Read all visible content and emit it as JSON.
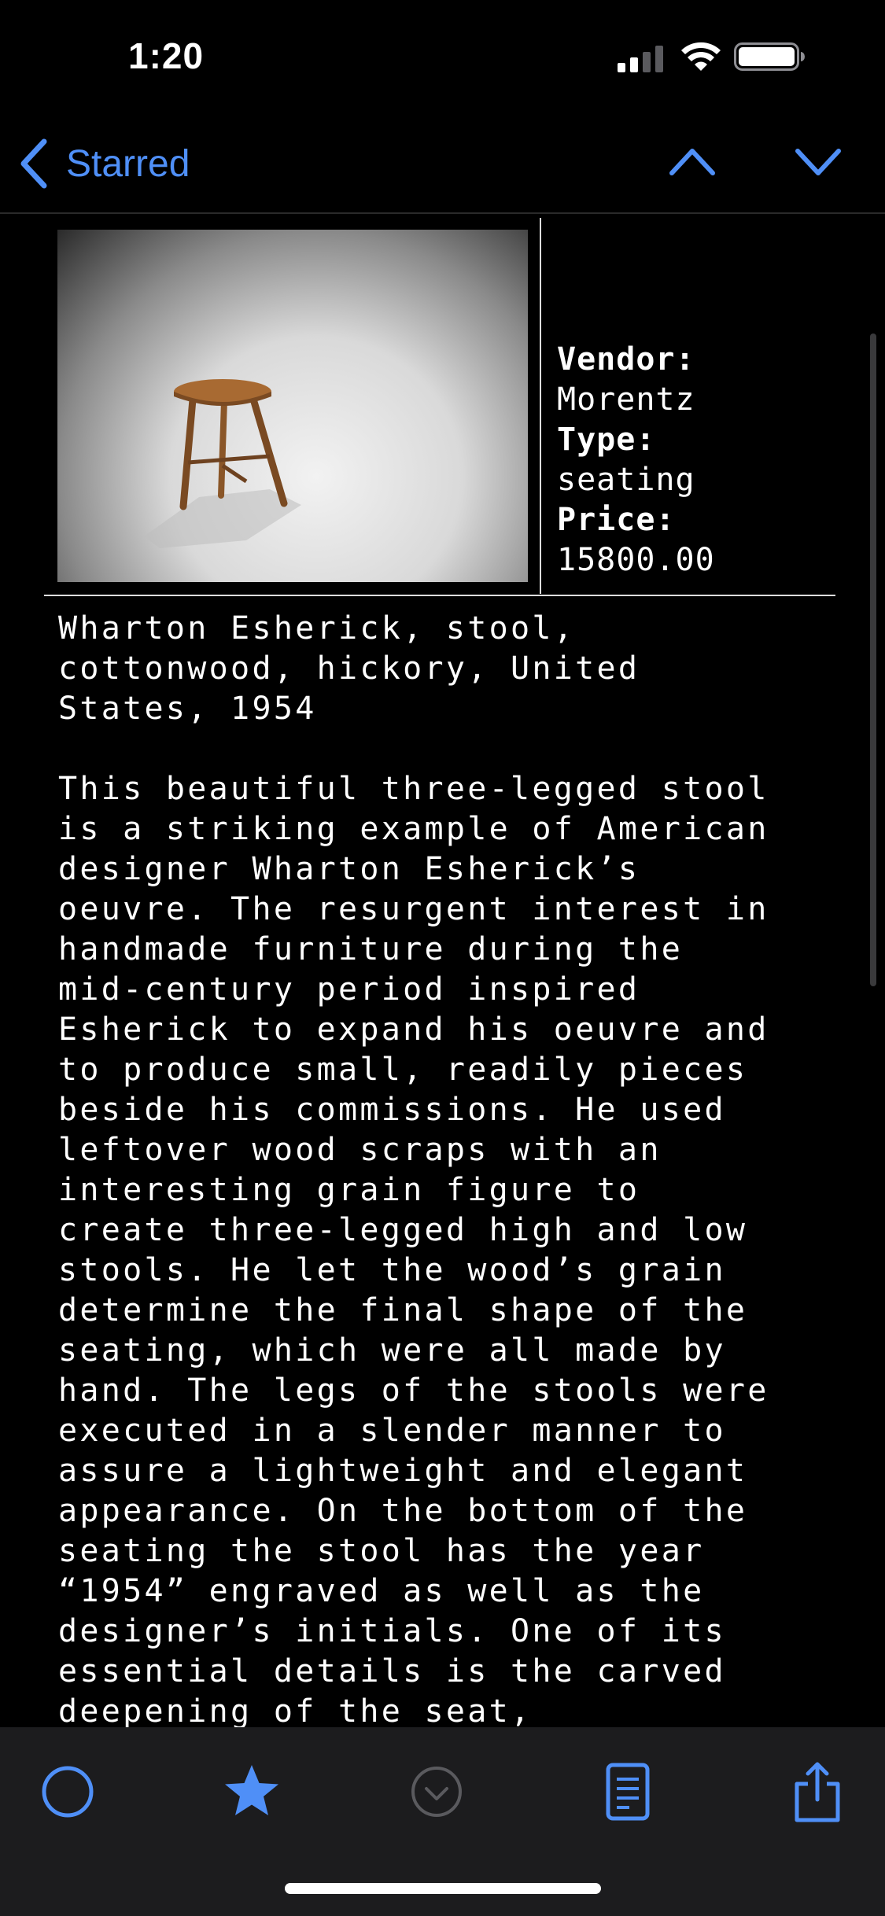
{
  "status_bar": {
    "time": "1:20",
    "icons": [
      "cellular-signal-icon",
      "wifi-icon",
      "battery-icon"
    ]
  },
  "nav": {
    "back_label": "Starred",
    "icons": [
      "chevron-left-icon",
      "chevron-up-icon",
      "chevron-down-icon"
    ]
  },
  "item": {
    "vendor_label": "Vendor:",
    "vendor": "Morentz",
    "type_label": "Type:",
    "type": "seating",
    "price_label": "Price:",
    "price": "15800.00",
    "description": "Wharton Esherick, stool,\ncottonwood, hickory, United\nStates, 1954\n\nThis beautiful three-legged stool\nis a striking example of American\ndesigner Wharton Esherick’s\noeuvre. The resurgent interest in\nhandmade furniture during the\nmid-century period inspired\nEsherick to expand his oeuvre and\nto produce small, readily pieces\nbeside his commissions. He used\nleftover wood scraps with an\ninteresting grain figure to\ncreate three-legged high and low\nstools. He let the wood’s grain\ndetermine the final shape of the\nseating, which were all made by\nhand. The legs of the stools were\nexecuted in a slender manner to\nassure a lightweight and elegant\nappearance. On the bottom of the\nseating the stool has the year\n“1954” engraved as well as the\ndesigner’s initials. One of its\nessential details is the carved\ndeepening of the seat,"
  },
  "tab_bar": {
    "tabs": [
      "circle-icon",
      "star-icon",
      "checkmark-circle-icon",
      "document-icon",
      "share-icon"
    ],
    "active_color": "#4f8ff7",
    "inactive_color": "#5a5a5e"
  }
}
